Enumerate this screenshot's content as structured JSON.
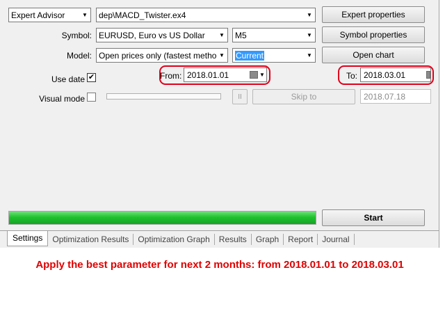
{
  "row1": {
    "type_select": "Expert Advisor",
    "ea_path": "dep\\MACD_Twister.ex4",
    "expert_properties_label": "Expert properties"
  },
  "row2": {
    "label": "Symbol:",
    "symbol_value": "EURUSD, Euro vs US Dollar",
    "timeframe_value": "M5",
    "symbol_properties_label": "Symbol properties"
  },
  "row3": {
    "label": "Model:",
    "model_value": "Open prices only (fastest method to",
    "spread_value": "Current",
    "open_chart_label": "Open chart"
  },
  "row4": {
    "use_date_label": "Use date",
    "use_date_checked": "✔",
    "from_label": "From:",
    "from_value": "2018.01.01",
    "to_label": "To:",
    "to_value": "2018.03.01"
  },
  "row5": {
    "visual_mode_label": "Visual mode",
    "pause_label": "II",
    "skip_to_label": "Skip to",
    "skip_date": "2018.07.18"
  },
  "progress": {
    "fraction": 1.0,
    "start_label": "Start"
  },
  "tabs": [
    {
      "label": "Settings"
    },
    {
      "label": "Optimization Results"
    },
    {
      "label": "Optimization Graph"
    },
    {
      "label": "Results"
    },
    {
      "label": "Graph"
    },
    {
      "label": "Report"
    },
    {
      "label": "Journal"
    }
  ],
  "caption": "Apply the best parameter for next 2 months: from 2018.01.01 to 2018.03.01",
  "colors": {
    "highlight": "#e0001b",
    "progress": "#1fc22e",
    "caption": "#e00000",
    "selection": "#3399ff"
  }
}
